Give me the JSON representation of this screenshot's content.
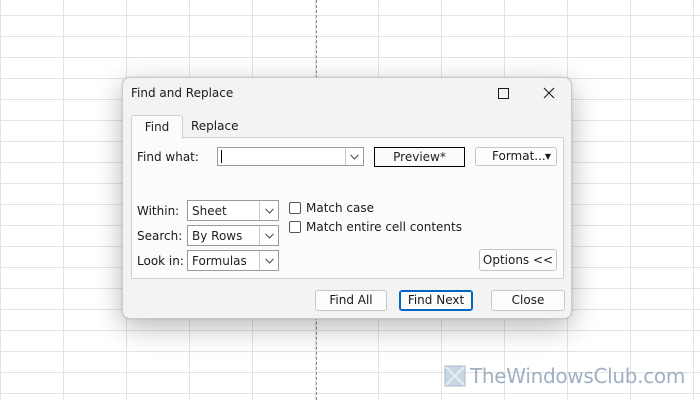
{
  "dialog": {
    "title": "Find and Replace"
  },
  "tabs": [
    {
      "label": "Find",
      "active": true
    },
    {
      "label": "Replace",
      "active": false
    }
  ],
  "find": {
    "label": "Find what:",
    "value": "",
    "preview": "Preview*",
    "format_button": "Format...",
    "within": {
      "label": "Within:",
      "value": "Sheet"
    },
    "search": {
      "label": "Search:",
      "value": "By Rows"
    },
    "look_in": {
      "label": "Look in:",
      "value": "Formulas"
    },
    "match_case": {
      "label": "Match case",
      "checked": false
    },
    "match_entire": {
      "label": "Match entire cell contents",
      "checked": false
    },
    "options_button": "Options <<"
  },
  "buttons": {
    "find_all": "Find All",
    "find_next": "Find Next",
    "close": "Close"
  },
  "watermark": {
    "text": "TheWindowsClub.com"
  },
  "colors": {
    "accent": "#0067c0",
    "dialog_bg": "#f3f3f3",
    "watermark": "#9fb0c2"
  },
  "icons": {
    "maximize": "maximize-icon",
    "close": "close-icon",
    "dropdown": "chevron-down-icon",
    "watermark_logo": "windows-club-logo-icon"
  }
}
